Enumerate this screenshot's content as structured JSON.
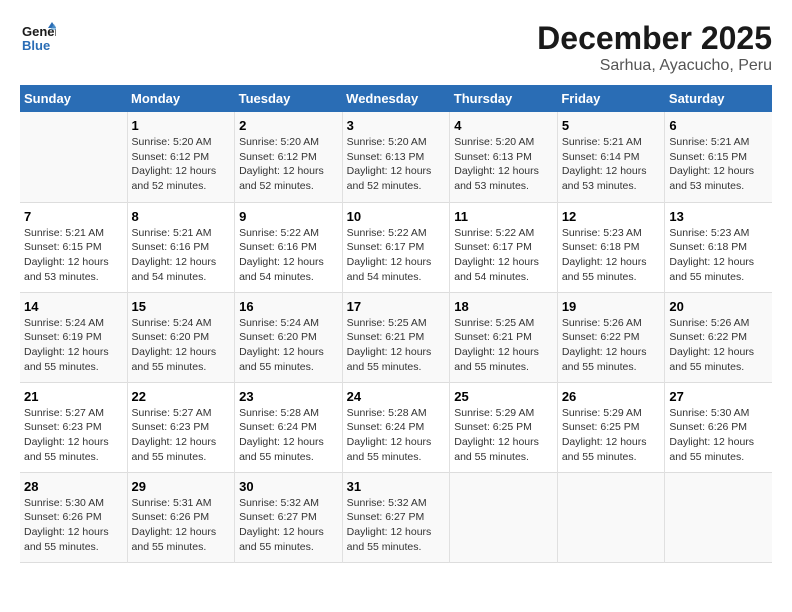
{
  "logo": {
    "line1": "General",
    "line2": "Blue"
  },
  "title": "December 2025",
  "subtitle": "Sarhua, Ayacucho, Peru",
  "headers": [
    "Sunday",
    "Monday",
    "Tuesday",
    "Wednesday",
    "Thursday",
    "Friday",
    "Saturday"
  ],
  "weeks": [
    [
      {
        "day": "",
        "info": ""
      },
      {
        "day": "1",
        "info": "Sunrise: 5:20 AM\nSunset: 6:12 PM\nDaylight: 12 hours\nand 52 minutes."
      },
      {
        "day": "2",
        "info": "Sunrise: 5:20 AM\nSunset: 6:12 PM\nDaylight: 12 hours\nand 52 minutes."
      },
      {
        "day": "3",
        "info": "Sunrise: 5:20 AM\nSunset: 6:13 PM\nDaylight: 12 hours\nand 52 minutes."
      },
      {
        "day": "4",
        "info": "Sunrise: 5:20 AM\nSunset: 6:13 PM\nDaylight: 12 hours\nand 53 minutes."
      },
      {
        "day": "5",
        "info": "Sunrise: 5:21 AM\nSunset: 6:14 PM\nDaylight: 12 hours\nand 53 minutes."
      },
      {
        "day": "6",
        "info": "Sunrise: 5:21 AM\nSunset: 6:15 PM\nDaylight: 12 hours\nand 53 minutes."
      }
    ],
    [
      {
        "day": "7",
        "info": "Sunrise: 5:21 AM\nSunset: 6:15 PM\nDaylight: 12 hours\nand 53 minutes."
      },
      {
        "day": "8",
        "info": "Sunrise: 5:21 AM\nSunset: 6:16 PM\nDaylight: 12 hours\nand 54 minutes."
      },
      {
        "day": "9",
        "info": "Sunrise: 5:22 AM\nSunset: 6:16 PM\nDaylight: 12 hours\nand 54 minutes."
      },
      {
        "day": "10",
        "info": "Sunrise: 5:22 AM\nSunset: 6:17 PM\nDaylight: 12 hours\nand 54 minutes."
      },
      {
        "day": "11",
        "info": "Sunrise: 5:22 AM\nSunset: 6:17 PM\nDaylight: 12 hours\nand 54 minutes."
      },
      {
        "day": "12",
        "info": "Sunrise: 5:23 AM\nSunset: 6:18 PM\nDaylight: 12 hours\nand 55 minutes."
      },
      {
        "day": "13",
        "info": "Sunrise: 5:23 AM\nSunset: 6:18 PM\nDaylight: 12 hours\nand 55 minutes."
      }
    ],
    [
      {
        "day": "14",
        "info": "Sunrise: 5:24 AM\nSunset: 6:19 PM\nDaylight: 12 hours\nand 55 minutes."
      },
      {
        "day": "15",
        "info": "Sunrise: 5:24 AM\nSunset: 6:20 PM\nDaylight: 12 hours\nand 55 minutes."
      },
      {
        "day": "16",
        "info": "Sunrise: 5:24 AM\nSunset: 6:20 PM\nDaylight: 12 hours\nand 55 minutes."
      },
      {
        "day": "17",
        "info": "Sunrise: 5:25 AM\nSunset: 6:21 PM\nDaylight: 12 hours\nand 55 minutes."
      },
      {
        "day": "18",
        "info": "Sunrise: 5:25 AM\nSunset: 6:21 PM\nDaylight: 12 hours\nand 55 minutes."
      },
      {
        "day": "19",
        "info": "Sunrise: 5:26 AM\nSunset: 6:22 PM\nDaylight: 12 hours\nand 55 minutes."
      },
      {
        "day": "20",
        "info": "Sunrise: 5:26 AM\nSunset: 6:22 PM\nDaylight: 12 hours\nand 55 minutes."
      }
    ],
    [
      {
        "day": "21",
        "info": "Sunrise: 5:27 AM\nSunset: 6:23 PM\nDaylight: 12 hours\nand 55 minutes."
      },
      {
        "day": "22",
        "info": "Sunrise: 5:27 AM\nSunset: 6:23 PM\nDaylight: 12 hours\nand 55 minutes."
      },
      {
        "day": "23",
        "info": "Sunrise: 5:28 AM\nSunset: 6:24 PM\nDaylight: 12 hours\nand 55 minutes."
      },
      {
        "day": "24",
        "info": "Sunrise: 5:28 AM\nSunset: 6:24 PM\nDaylight: 12 hours\nand 55 minutes."
      },
      {
        "day": "25",
        "info": "Sunrise: 5:29 AM\nSunset: 6:25 PM\nDaylight: 12 hours\nand 55 minutes."
      },
      {
        "day": "26",
        "info": "Sunrise: 5:29 AM\nSunset: 6:25 PM\nDaylight: 12 hours\nand 55 minutes."
      },
      {
        "day": "27",
        "info": "Sunrise: 5:30 AM\nSunset: 6:26 PM\nDaylight: 12 hours\nand 55 minutes."
      }
    ],
    [
      {
        "day": "28",
        "info": "Sunrise: 5:30 AM\nSunset: 6:26 PM\nDaylight: 12 hours\nand 55 minutes."
      },
      {
        "day": "29",
        "info": "Sunrise: 5:31 AM\nSunset: 6:26 PM\nDaylight: 12 hours\nand 55 minutes."
      },
      {
        "day": "30",
        "info": "Sunrise: 5:32 AM\nSunset: 6:27 PM\nDaylight: 12 hours\nand 55 minutes."
      },
      {
        "day": "31",
        "info": "Sunrise: 5:32 AM\nSunset: 6:27 PM\nDaylight: 12 hours\nand 55 minutes."
      },
      {
        "day": "",
        "info": ""
      },
      {
        "day": "",
        "info": ""
      },
      {
        "day": "",
        "info": ""
      }
    ]
  ]
}
